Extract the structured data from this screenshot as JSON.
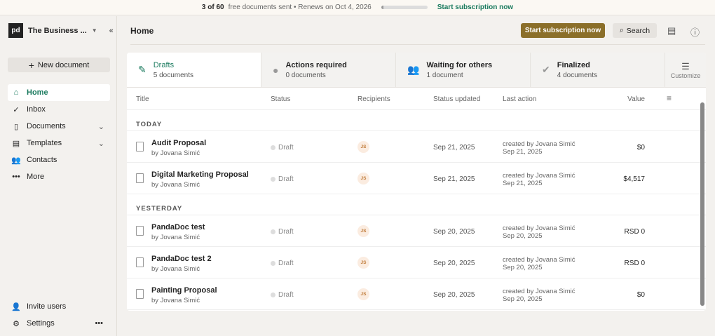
{
  "banner": {
    "count": "3 of 60",
    "text": "free documents sent • Renews on Oct 4, 2026",
    "progress": 0.05,
    "link": "Start subscription now"
  },
  "sidebar": {
    "logo": "pd",
    "org": "The Business ...",
    "new_document": "New document",
    "items": [
      {
        "label": "Home",
        "icon": "home-icon"
      },
      {
        "label": "Inbox",
        "icon": "check-circle-icon"
      },
      {
        "label": "Documents",
        "icon": "document-icon"
      },
      {
        "label": "Templates",
        "icon": "template-icon"
      },
      {
        "label": "Contacts",
        "icon": "contacts-icon"
      },
      {
        "label": "More",
        "icon": "more-icon"
      }
    ],
    "invite": "Invite users",
    "settings": "Settings"
  },
  "header": {
    "title": "Home",
    "subscribe": "Start subscription now",
    "search": "Search"
  },
  "tabs": [
    {
      "label": "Drafts",
      "count": "5 documents"
    },
    {
      "label": "Actions required",
      "count": "0 documents"
    },
    {
      "label": "Waiting for others",
      "count": "1 document"
    },
    {
      "label": "Finalized",
      "count": "4 documents"
    }
  ],
  "customize": "Customize",
  "columns": {
    "title": "Title",
    "status": "Status",
    "recipients": "Recipients",
    "updated": "Status updated",
    "last": "Last action",
    "value": "Value"
  },
  "groups": [
    {
      "label": "TODAY",
      "rows": [
        {
          "name": "Audit Proposal",
          "by": "by Jovana Simić",
          "status": "Draft",
          "rec": "JS",
          "updated": "Sep 21, 2025",
          "last1": "created by Jovana Simić",
          "last2": "Sep 21, 2025",
          "value": "$0"
        },
        {
          "name": "Digital Marketing Proposal",
          "by": "by Jovana Simić",
          "status": "Draft",
          "rec": "JS",
          "updated": "Sep 21, 2025",
          "last1": "created by Jovana Simić",
          "last2": "Sep 21, 2025",
          "value": "$4,517"
        }
      ]
    },
    {
      "label": "YESTERDAY",
      "rows": [
        {
          "name": "PandaDoc test",
          "by": "by Jovana Simić",
          "status": "Draft",
          "rec": "JS",
          "updated": "Sep 20, 2025",
          "last1": "created by Jovana Simić",
          "last2": "Sep 20, 2025",
          "value": "RSD 0"
        },
        {
          "name": "PandaDoc test 2",
          "by": "by Jovana Simić",
          "status": "Draft",
          "rec": "JS",
          "updated": "Sep 20, 2025",
          "last1": "created by Jovana Simić",
          "last2": "Sep 20, 2025",
          "value": "RSD 0"
        },
        {
          "name": "Painting Proposal",
          "by": "by Jovana Simić",
          "status": "Draft",
          "rec": "JS",
          "updated": "Sep 20, 2025",
          "last1": "created by Jovana Simić",
          "last2": "Sep 20, 2025",
          "value": "$0"
        }
      ]
    }
  ]
}
